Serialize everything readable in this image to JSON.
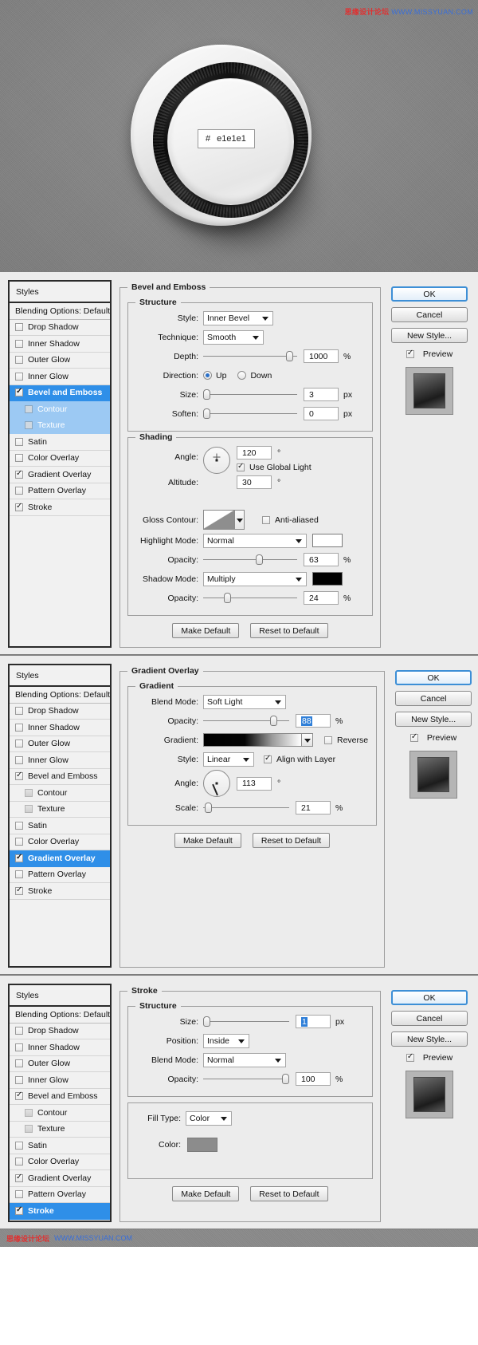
{
  "hero": {
    "hex_symbol": "#",
    "hex_value": "e1e1e1",
    "watermark_prefix": "思缘设计论坛",
    "watermark_url": "WWW.MISSYUAN.COM"
  },
  "footer": {
    "watermark_prefix": "思缘设计论坛",
    "watermark_url": "WWW.MISSYUAN.COM"
  },
  "common": {
    "styles_header": "Styles",
    "blending_options": "Blending Options: Default",
    "make_default": "Make Default",
    "reset_to_default": "Reset to Default",
    "ok": "OK",
    "cancel": "Cancel",
    "new_style": "New Style...",
    "preview": "Preview",
    "percent": "%",
    "px": "px",
    "degree": "°"
  },
  "style_items": [
    {
      "label": "Drop Shadow",
      "checked": false,
      "indent": false,
      "selected": false
    },
    {
      "label": "Inner Shadow",
      "checked": false,
      "indent": false,
      "selected": false
    },
    {
      "label": "Outer Glow",
      "checked": false,
      "indent": false,
      "selected": false
    },
    {
      "label": "Inner Glow",
      "checked": false,
      "indent": false,
      "selected": false
    },
    {
      "label": "Bevel and Emboss",
      "checked": true,
      "indent": false,
      "selected": false
    },
    {
      "label": "Contour",
      "checked": false,
      "indent": true,
      "selected": false
    },
    {
      "label": "Texture",
      "checked": false,
      "indent": true,
      "selected": false
    },
    {
      "label": "Satin",
      "checked": false,
      "indent": false,
      "selected": false
    },
    {
      "label": "Color Overlay",
      "checked": false,
      "indent": false,
      "selected": false
    },
    {
      "label": "Gradient Overlay",
      "checked": true,
      "indent": false,
      "selected": false
    },
    {
      "label": "Pattern Overlay",
      "checked": false,
      "indent": false,
      "selected": false
    },
    {
      "label": "Stroke",
      "checked": true,
      "indent": false,
      "selected": false
    }
  ],
  "panel1": {
    "title": "Bevel and Emboss",
    "structure_legend": "Structure",
    "shading_legend": "Shading",
    "labels": {
      "style": "Style:",
      "technique": "Technique:",
      "depth": "Depth:",
      "direction": "Direction:",
      "size": "Size:",
      "soften": "Soften:",
      "angle": "Angle:",
      "altitude": "Altitude:",
      "gloss_contour": "Gloss Contour:",
      "highlight_mode": "Highlight Mode:",
      "opacity": "Opacity:",
      "shadow_mode": "Shadow Mode:",
      "use_global_light": "Use Global Light",
      "anti_aliased": "Anti-aliased",
      "up": "Up",
      "down": "Down"
    },
    "values": {
      "style": "Inner Bevel",
      "technique": "Smooth",
      "depth": "1000",
      "direction": "Up",
      "size": "3",
      "soften": "0",
      "angle": "120",
      "altitude": "30",
      "highlight_mode": "Normal",
      "highlight_opacity": "63",
      "shadow_mode": "Multiply",
      "shadow_opacity": "24",
      "highlight_color": "#ffffff",
      "shadow_color": "#000000",
      "use_global_light_checked": true,
      "anti_aliased_checked": false
    },
    "selected_style": "Bevel and Emboss"
  },
  "panel2": {
    "title": "Gradient Overlay",
    "gradient_legend": "Gradient",
    "labels": {
      "blend_mode": "Blend Mode:",
      "opacity": "Opacity:",
      "gradient": "Gradient:",
      "reverse": "Reverse",
      "style": "Style:",
      "align_with_layer": "Align with Layer",
      "angle": "Angle:",
      "scale": "Scale:"
    },
    "values": {
      "blend_mode": "Soft Light",
      "opacity": "88",
      "style": "Linear",
      "angle": "113",
      "scale": "21",
      "reverse_checked": false,
      "align_with_layer_checked": true
    },
    "selected_style": "Gradient Overlay"
  },
  "panel3": {
    "title": "Stroke",
    "structure_legend": "Structure",
    "labels": {
      "size": "Size:",
      "position": "Position:",
      "blend_mode": "Blend Mode:",
      "opacity": "Opacity:",
      "fill_type": "Fill Type:",
      "color": "Color:"
    },
    "values": {
      "size": "1",
      "position": "Inside",
      "blend_mode": "Normal",
      "opacity": "100",
      "fill_type": "Color",
      "color_swatch": "#8c8c8c"
    },
    "selected_style": "Stroke"
  }
}
